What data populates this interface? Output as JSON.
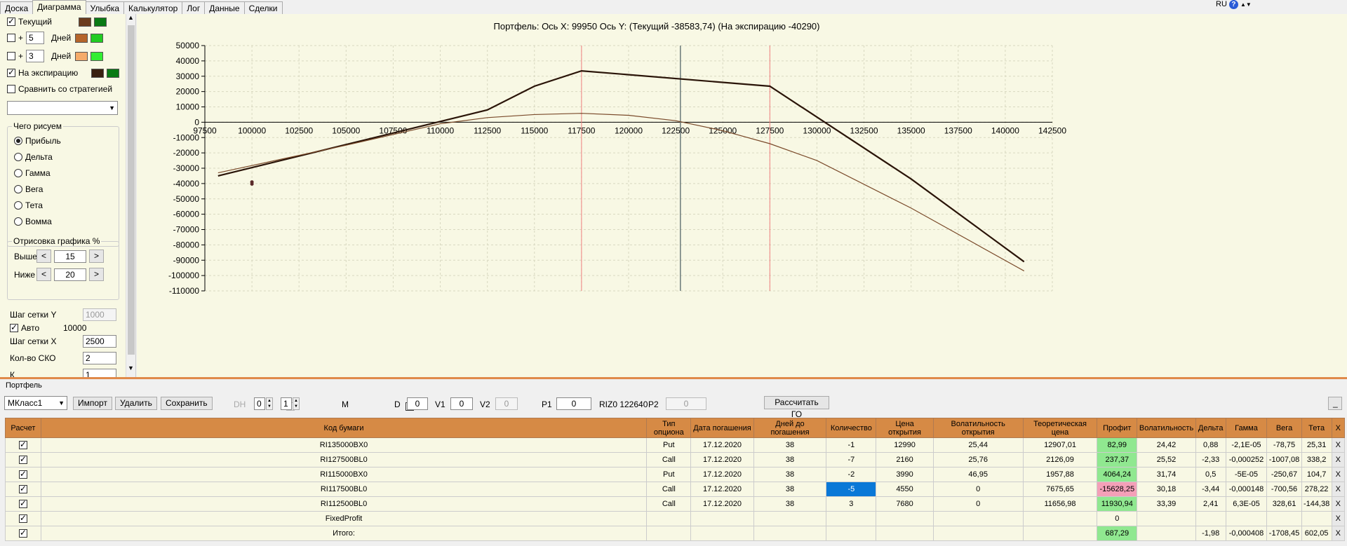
{
  "tabs": [
    "Доска",
    "Диаграмма",
    "Улыбка",
    "Калькулятор",
    "Лог",
    "Данные",
    "Сделки"
  ],
  "active_tab": 1,
  "topright": {
    "lang": "RU",
    "help": "?"
  },
  "left": {
    "current_label": "Текущий",
    "plus1": "+",
    "days1": "5",
    "days_label1": "Дней",
    "plus2": "+",
    "days2": "3",
    "days_label2": "Дней",
    "expiry_label": "На экспирацию",
    "compare_label": "Сравнить со стратегией",
    "draw_group": "Чего рисуем",
    "options": [
      "Прибыль",
      "Дельта",
      "Гамма",
      "Вега",
      "Тета",
      "Вомма"
    ],
    "render_group": "Отрисовка графика %",
    "above_label": "Выше",
    "above_value": "15",
    "below_label": "Ниже",
    "below_value": "20",
    "prev": "<",
    "next": ">",
    "grid_y_label": "Шаг сетки Y",
    "grid_y_value": "1000",
    "auto_label": "Авто",
    "auto_value": "10000",
    "grid_x_label": "Шаг сетки X",
    "grid_x_value": "2500",
    "sko_label": "Кол-во СКО",
    "sko_value": "2",
    "cut_label": "К",
    "cut_value": "1"
  },
  "colors": {
    "current_main": "#6b3c1c",
    "current_alt": "#0a7a14",
    "d5_main": "#b5652a",
    "d5_alt": "#22cc22",
    "d3_main": "#f5ab6a",
    "d3_alt": "#33ee33",
    "exp_main": "#3a2010",
    "exp_alt": "#0a7a14"
  },
  "chart_data": {
    "type": "line",
    "title": "Портфель: Ось X: 99950 Ось Y:  (Текущий -38583,74)  (На экспирацию -40290)",
    "xlim": [
      97500,
      142500
    ],
    "ylim": [
      -110000,
      50000
    ],
    "x_ticks": [
      97500,
      100000,
      102500,
      105000,
      107500,
      110000,
      112500,
      115000,
      117500,
      120000,
      122500,
      125000,
      127500,
      130000,
      132500,
      135000,
      137500,
      140000,
      142500
    ],
    "y_ticks": [
      50000,
      40000,
      30000,
      20000,
      10000,
      0,
      -10000,
      -20000,
      -30000,
      -40000,
      -50000,
      -60000,
      -70000,
      -80000,
      -90000,
      -100000,
      -110000
    ],
    "vlines_red": [
      117500,
      127500
    ],
    "vline_current": 122750,
    "series": [
      {
        "color": "#2a1408",
        "x": [
          98200,
          112500,
          115000,
          117500,
          127500,
          135000,
          141000
        ],
        "y": [
          -35000,
          8000,
          23500,
          33500,
          23500,
          -37000,
          -91000
        ]
      },
      {
        "color": "#7a4a2a",
        "x": [
          98200,
          105000,
          110000,
          112500,
          115000,
          117500,
          120000,
          122500,
          125000,
          127500,
          130000,
          135000,
          141000
        ],
        "y": [
          -33000,
          -15000,
          -1000,
          3000,
          5000,
          5800,
          4500,
          1000,
          -5500,
          -14000,
          -25000,
          -56000,
          -97000
        ]
      }
    ],
    "points": [
      {
        "x": 100000,
        "y": -39000
      },
      {
        "x": 100000,
        "y": -40300
      }
    ]
  },
  "portfolio_label": "Портфель",
  "toolbar": {
    "select": "MКласс1",
    "import": "Импорт",
    "delete": "Удалить",
    "save": "Сохранить",
    "dh": "DH",
    "s1": "0",
    "s2": "1",
    "m": "M",
    "d_label": "D",
    "d_val": "0",
    "v1_label": "V1",
    "v1_val": "0",
    "v2_label": "V2",
    "v2_val": "0",
    "p1_label": "P1",
    "p1_val": "0",
    "riz": "RIZ0 122640",
    "p2_label": "P2",
    "p2_val": "0",
    "calc_go": "Рассчитать ГО",
    "minbtn": "_"
  },
  "table": {
    "headers": [
      "Расчет",
      "Код бумаги",
      "Тип опциона",
      "Дата погашения",
      "Дней до погашения",
      "Количество",
      "Цена открытия",
      "Волатильность открытия",
      "Теоретическая цена",
      "Профит",
      "Волатильность",
      "Дельта",
      "Гамма",
      "Вега",
      "Тета",
      "X"
    ],
    "rows": [
      [
        "RI135000BX0",
        "Put",
        "17.12.2020",
        "38",
        "-1",
        "12990",
        "25,44",
        "12907,01",
        "82,99",
        "24,42",
        "0,88",
        "-2,1E-05",
        "-78,75",
        "25,31",
        "X"
      ],
      [
        "RI127500BL0",
        "Call",
        "17.12.2020",
        "38",
        "-7",
        "2160",
        "25,76",
        "2126,09",
        "237,37",
        "25,52",
        "-2,33",
        "-0,000252",
        "-1007,08",
        "338,2",
        "X"
      ],
      [
        "RI115000BX0",
        "Put",
        "17.12.2020",
        "38",
        "-2",
        "3990",
        "46,95",
        "1957,88",
        "4064,24",
        "31,74",
        "0,5",
        "-5E-05",
        "-250,67",
        "104,7",
        "X"
      ],
      [
        "RI117500BL0",
        "Call",
        "17.12.2020",
        "38",
        "-5",
        "4550",
        "0",
        "7675,65",
        "-15628,25",
        "30,18",
        "-3,44",
        "-0,000148",
        "-700,56",
        "278,22",
        "X"
      ],
      [
        "RI112500BL0",
        "Call",
        "17.12.2020",
        "38",
        "3",
        "7680",
        "0",
        "11656,98",
        "11930,94",
        "33,39",
        "2,41",
        "6,3E-05",
        "328,61",
        "-144,38",
        "X"
      ],
      [
        "FixedProfit",
        "",
        "",
        "",
        "",
        "",
        "",
        "",
        "0",
        "",
        "",
        "",
        "",
        "",
        "X"
      ],
      [
        "Итого:",
        "",
        "",
        "",
        "",
        "",
        "",
        "",
        "687,29",
        "",
        "-1,98",
        "-0,000408",
        "-1708,45",
        "602,05",
        "X"
      ]
    ]
  }
}
